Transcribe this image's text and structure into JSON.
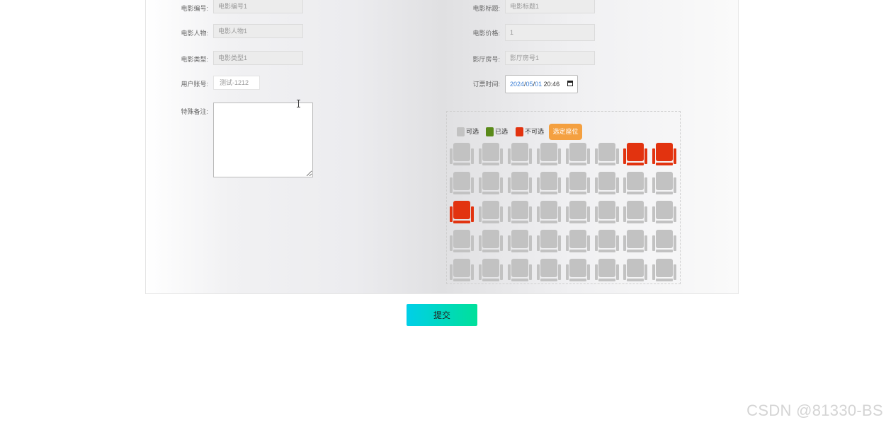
{
  "form": {
    "movie_id_label": "电影编号:",
    "movie_id_value": "电影编号1",
    "movie_title_label": "电影标题:",
    "movie_title_value": "电影标题1",
    "movie_people_label": "电影人物:",
    "movie_people_value": "电影人物1",
    "movie_price_label": "电影价格:",
    "movie_price_value": "1",
    "movie_type_label": "电影类型:",
    "movie_type_value": "电影类型1",
    "hall_label": "影厅房号:",
    "hall_value": "影厅房号1",
    "account_label": "用户账号:",
    "account_value": "测试-1212",
    "order_time_label": "订票时间:",
    "order_time_year": "2024",
    "order_time_month": "05",
    "order_time_day": "01",
    "order_time_clock": "20:46",
    "remark_label": "特殊备注:"
  },
  "legend": {
    "available": "可选",
    "selected": "已选",
    "unavailable": "不可选",
    "pick_button": "选定座位"
  },
  "colors": {
    "available": "#c2c2c2",
    "selected": "#5a8a1a",
    "unavailable": "#e2330f",
    "pick_button": "#f4a040"
  },
  "seats": [
    [
      "available",
      "available",
      "available",
      "available",
      "available",
      "available",
      "unavailable",
      "unavailable"
    ],
    [
      "available",
      "available",
      "available",
      "available",
      "available",
      "available",
      "available",
      "available"
    ],
    [
      "unavailable",
      "available",
      "available",
      "available",
      "available",
      "available",
      "available",
      "available"
    ],
    [
      "available",
      "available",
      "available",
      "available",
      "available",
      "available",
      "available",
      "available"
    ],
    [
      "available",
      "available",
      "available",
      "available",
      "available",
      "available",
      "available",
      "available"
    ]
  ],
  "submit_label": "提交",
  "watermark": "CSDN @81330-BS"
}
